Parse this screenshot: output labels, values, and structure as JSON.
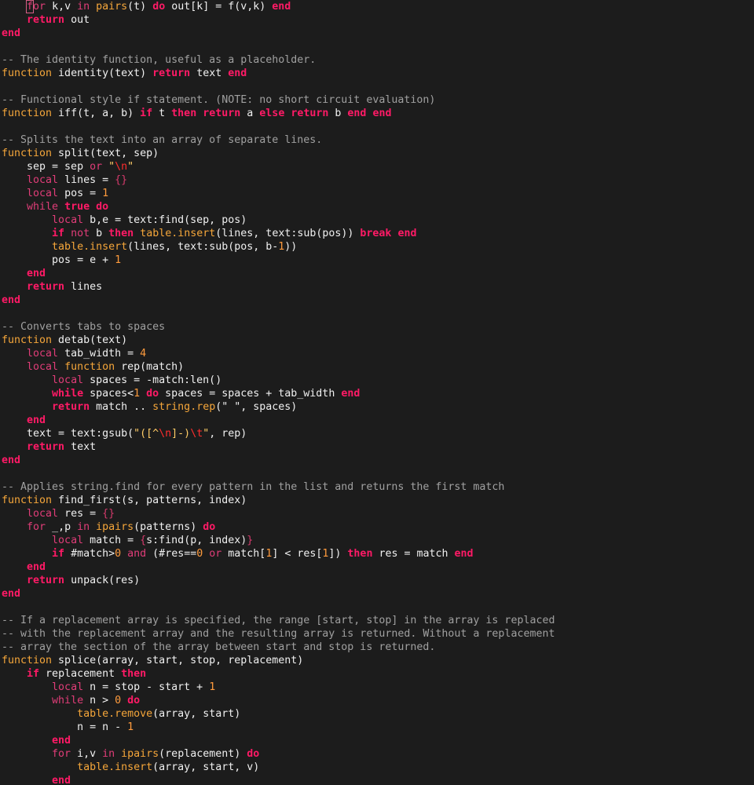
{
  "theme": {
    "background": "#1c1c1c",
    "text": "#f0f0f0",
    "keyword": "#ff1a66",
    "builtin_keyword": "#e03d78",
    "library_call": "#f5a63a",
    "comment": "#a0a0a0",
    "string": "#ffcc66",
    "escape": "#ff2d2d",
    "number": "#ff9b3d",
    "brace": "#d43a6c"
  },
  "editor": {
    "cursor": {
      "line": 1,
      "token": 1
    },
    "lines": [
      [
        [
          "tx",
          "    "
        ],
        [
          "kw2",
          "for"
        ],
        [
          "tx",
          " k,v "
        ],
        [
          "kw2",
          "in"
        ],
        [
          "fn",
          " pairs"
        ],
        [
          "tx",
          "(t) "
        ],
        [
          "kw",
          "do"
        ],
        [
          "tx",
          " out[k] = f(v,k) "
        ],
        [
          "kw",
          "end"
        ]
      ],
      [
        [
          "tx",
          "    "
        ],
        [
          "kw",
          "return"
        ],
        [
          "tx",
          " out"
        ]
      ],
      [
        [
          "kw",
          "end"
        ]
      ],
      [],
      [
        [
          "cm",
          "-- The identity function, useful as a placeholder."
        ]
      ],
      [
        [
          "fn",
          "function"
        ],
        [
          "tx",
          " identity(text) "
        ],
        [
          "kw",
          "return"
        ],
        [
          "tx",
          " text "
        ],
        [
          "kw",
          "end"
        ]
      ],
      [],
      [
        [
          "cm",
          "-- Functional style if statement. (NOTE: no short circuit evaluation)"
        ]
      ],
      [
        [
          "fn",
          "function"
        ],
        [
          "tx",
          " iff(t, a, b) "
        ],
        [
          "kw",
          "if"
        ],
        [
          "tx",
          " t "
        ],
        [
          "kw",
          "then"
        ],
        [
          "tx",
          " "
        ],
        [
          "kw",
          "return"
        ],
        [
          "tx",
          " a "
        ],
        [
          "kw",
          "else"
        ],
        [
          "tx",
          " "
        ],
        [
          "kw",
          "return"
        ],
        [
          "tx",
          " b "
        ],
        [
          "kw",
          "end"
        ],
        [
          "tx",
          " "
        ],
        [
          "kw",
          "end"
        ]
      ],
      [],
      [
        [
          "cm",
          "-- Splits the text into an array of separate lines."
        ]
      ],
      [
        [
          "fn",
          "function"
        ],
        [
          "tx",
          " split(text, sep)"
        ]
      ],
      [
        [
          "tx",
          "    sep = sep "
        ],
        [
          "kw2",
          "or"
        ],
        [
          "tx",
          " "
        ],
        [
          "st",
          "\""
        ],
        [
          "es",
          "\\n"
        ],
        [
          "st",
          "\""
        ]
      ],
      [
        [
          "tx",
          "    "
        ],
        [
          "kw2",
          "local"
        ],
        [
          "tx",
          " lines = "
        ],
        [
          "bt",
          "{}"
        ]
      ],
      [
        [
          "tx",
          "    "
        ],
        [
          "kw2",
          "local"
        ],
        [
          "tx",
          " pos = "
        ],
        [
          "nm",
          "1"
        ]
      ],
      [
        [
          "tx",
          "    "
        ],
        [
          "kw2",
          "while"
        ],
        [
          "tx",
          " "
        ],
        [
          "kw",
          "true"
        ],
        [
          "tx",
          " "
        ],
        [
          "kw",
          "do"
        ]
      ],
      [
        [
          "tx",
          "        "
        ],
        [
          "kw2",
          "local"
        ],
        [
          "tx",
          " b,e = text:find(sep, pos)"
        ]
      ],
      [
        [
          "tx",
          "        "
        ],
        [
          "kw",
          "if"
        ],
        [
          "tx",
          " "
        ],
        [
          "kw2",
          "not"
        ],
        [
          "tx",
          " b "
        ],
        [
          "kw",
          "then"
        ],
        [
          "tx",
          " "
        ],
        [
          "fn",
          "table.insert"
        ],
        [
          "tx",
          "(lines, text:sub(pos)) "
        ],
        [
          "kw",
          "break"
        ],
        [
          "tx",
          " "
        ],
        [
          "kw",
          "end"
        ]
      ],
      [
        [
          "tx",
          "        "
        ],
        [
          "fn",
          "table.insert"
        ],
        [
          "tx",
          "(lines, text:sub(pos, b-"
        ],
        [
          "nm",
          "1"
        ],
        [
          "tx",
          "))"
        ]
      ],
      [
        [
          "tx",
          "        pos = e + "
        ],
        [
          "nm",
          "1"
        ]
      ],
      [
        [
          "tx",
          "    "
        ],
        [
          "kw",
          "end"
        ]
      ],
      [
        [
          "tx",
          "    "
        ],
        [
          "kw",
          "return"
        ],
        [
          "tx",
          " lines"
        ]
      ],
      [
        [
          "kw",
          "end"
        ]
      ],
      [],
      [
        [
          "cm",
          "-- Converts tabs to spaces"
        ]
      ],
      [
        [
          "fn",
          "function"
        ],
        [
          "tx",
          " detab(text)"
        ]
      ],
      [
        [
          "tx",
          "    "
        ],
        [
          "kw2",
          "local"
        ],
        [
          "tx",
          " tab_width = "
        ],
        [
          "nm",
          "4"
        ]
      ],
      [
        [
          "tx",
          "    "
        ],
        [
          "kw2",
          "local"
        ],
        [
          "tx",
          " "
        ],
        [
          "fn",
          "function"
        ],
        [
          "tx",
          " rep(match)"
        ]
      ],
      [
        [
          "tx",
          "        "
        ],
        [
          "kw2",
          "local"
        ],
        [
          "tx",
          " spaces = -match:len()"
        ]
      ],
      [
        [
          "tx",
          "        "
        ],
        [
          "kw",
          "while"
        ],
        [
          "tx",
          " spaces<"
        ],
        [
          "nm",
          "1"
        ],
        [
          "tx",
          " "
        ],
        [
          "kw",
          "do"
        ],
        [
          "tx",
          " spaces = spaces + tab_width "
        ],
        [
          "kw",
          "end"
        ]
      ],
      [
        [
          "tx",
          "        "
        ],
        [
          "kw",
          "return"
        ],
        [
          "tx",
          " match .. "
        ],
        [
          "fn",
          "string.rep"
        ],
        [
          "tx",
          "(\" \", spaces)"
        ]
      ],
      [
        [
          "tx",
          "    "
        ],
        [
          "kw",
          "end"
        ]
      ],
      [
        [
          "tx",
          "    text = text:gsub("
        ],
        [
          "st",
          "\"([^"
        ],
        [
          "es",
          "\\n"
        ],
        [
          "st",
          "]-)"
        ],
        [
          "es",
          "\\t"
        ],
        [
          "st",
          "\""
        ],
        [
          "tx",
          ", rep)"
        ]
      ],
      [
        [
          "tx",
          "    "
        ],
        [
          "kw",
          "return"
        ],
        [
          "tx",
          " text"
        ]
      ],
      [
        [
          "kw",
          "end"
        ]
      ],
      [],
      [
        [
          "cm",
          "-- Applies string.find for every pattern in the list and returns the first match"
        ]
      ],
      [
        [
          "fn",
          "function"
        ],
        [
          "tx",
          " find_first(s, patterns, index)"
        ]
      ],
      [
        [
          "tx",
          "    "
        ],
        [
          "kw2",
          "local"
        ],
        [
          "tx",
          " res = "
        ],
        [
          "bt",
          "{}"
        ]
      ],
      [
        [
          "tx",
          "    "
        ],
        [
          "kw2",
          "for"
        ],
        [
          "tx",
          " _,p "
        ],
        [
          "kw2",
          "in"
        ],
        [
          "fn",
          " ipairs"
        ],
        [
          "tx",
          "(patterns) "
        ],
        [
          "kw",
          "do"
        ]
      ],
      [
        [
          "tx",
          "        "
        ],
        [
          "kw2",
          "local"
        ],
        [
          "tx",
          " match = "
        ],
        [
          "bt",
          "{"
        ],
        [
          "tx",
          "s:find(p, index)"
        ],
        [
          "bt",
          "}"
        ]
      ],
      [
        [
          "tx",
          "        "
        ],
        [
          "kw",
          "if"
        ],
        [
          "tx",
          " #match>"
        ],
        [
          "nm",
          "0"
        ],
        [
          "tx",
          " "
        ],
        [
          "kw2",
          "and"
        ],
        [
          "tx",
          " (#res=="
        ],
        [
          "nm",
          "0"
        ],
        [
          "tx",
          " "
        ],
        [
          "kw2",
          "or"
        ],
        [
          "tx",
          " match["
        ],
        [
          "nm",
          "1"
        ],
        [
          "tx",
          "] < res["
        ],
        [
          "nm",
          "1"
        ],
        [
          "tx",
          "]) "
        ],
        [
          "kw",
          "then"
        ],
        [
          "tx",
          " res = match "
        ],
        [
          "kw",
          "end"
        ]
      ],
      [
        [
          "tx",
          "    "
        ],
        [
          "kw",
          "end"
        ]
      ],
      [
        [
          "tx",
          "    "
        ],
        [
          "kw",
          "return"
        ],
        [
          "tx",
          " unpack(res)"
        ]
      ],
      [
        [
          "kw",
          "end"
        ]
      ],
      [],
      [
        [
          "cm",
          "-- If a replacement array is specified, the range [start, stop] in the array is replaced"
        ]
      ],
      [
        [
          "cm",
          "-- with the replacement array and the resulting array is returned. Without a replacement"
        ]
      ],
      [
        [
          "cm",
          "-- array the section of the array between start and stop is returned."
        ]
      ],
      [
        [
          "fn",
          "function"
        ],
        [
          "tx",
          " splice(array, start, stop, replacement)"
        ]
      ],
      [
        [
          "tx",
          "    "
        ],
        [
          "kw",
          "if"
        ],
        [
          "tx",
          " replacement "
        ],
        [
          "kw",
          "then"
        ]
      ],
      [
        [
          "tx",
          "        "
        ],
        [
          "kw2",
          "local"
        ],
        [
          "tx",
          " n = stop - start + "
        ],
        [
          "nm",
          "1"
        ]
      ],
      [
        [
          "tx",
          "        "
        ],
        [
          "kw2",
          "while"
        ],
        [
          "tx",
          " n > "
        ],
        [
          "nm",
          "0"
        ],
        [
          "tx",
          " "
        ],
        [
          "kw",
          "do"
        ]
      ],
      [
        [
          "tx",
          "            "
        ],
        [
          "fn",
          "table.remove"
        ],
        [
          "tx",
          "(array, start)"
        ]
      ],
      [
        [
          "tx",
          "            n = n - "
        ],
        [
          "nm",
          "1"
        ]
      ],
      [
        [
          "tx",
          "        "
        ],
        [
          "kw",
          "end"
        ]
      ],
      [
        [
          "tx",
          "        "
        ],
        [
          "kw2",
          "for"
        ],
        [
          "tx",
          " i,v "
        ],
        [
          "kw2",
          "in"
        ],
        [
          "fn",
          " ipairs"
        ],
        [
          "tx",
          "(replacement) "
        ],
        [
          "kw",
          "do"
        ]
      ],
      [
        [
          "tx",
          "            "
        ],
        [
          "fn",
          "table.insert"
        ],
        [
          "tx",
          "(array, start, v)"
        ]
      ],
      [
        [
          "tx",
          "        "
        ],
        [
          "kw",
          "end"
        ]
      ]
    ]
  }
}
